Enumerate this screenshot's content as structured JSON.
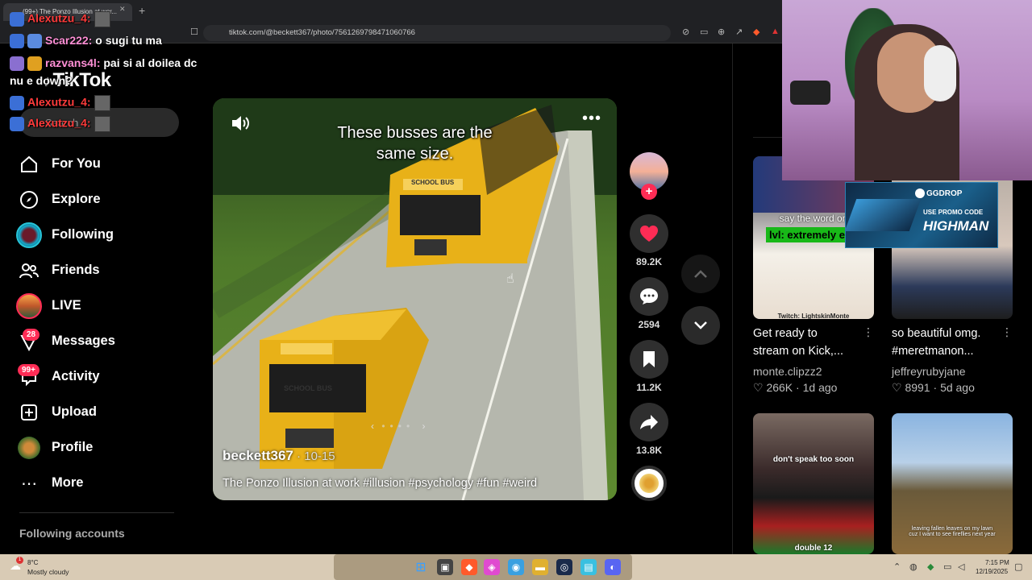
{
  "browser": {
    "tab_title": "(99+) The Ponzo Illusion at wor...",
    "url": "tiktok.com/@beckett367/photo/7561269798471060766"
  },
  "chat": [
    {
      "user": "Alexutzu_4:",
      "message": "",
      "color": "#ff3b3b"
    },
    {
      "user": "Scar222:",
      "message": "o sugi tu ma",
      "color": "#ff8fd6"
    },
    {
      "user": "razvans4l:",
      "message": "pai si al doilea dc",
      "color": "#ff8fd6"
    },
    {
      "user": "",
      "message": "nu e down?",
      "color": "#ffffff"
    },
    {
      "user": "Alexutzu_4:",
      "message": "",
      "color": "#ff3b3b"
    },
    {
      "user": "Alexutzu_4:",
      "message": "",
      "color": "#ff3b3b"
    }
  ],
  "app": {
    "logo": "TikTok",
    "search_placeholder": "Search"
  },
  "nav": [
    {
      "label": "For You",
      "icon": "home-icon"
    },
    {
      "label": "Explore",
      "icon": "compass-icon"
    },
    {
      "label": "Following",
      "icon": "following-avatar-icon"
    },
    {
      "label": "Friends",
      "icon": "friends-icon"
    },
    {
      "label": "LIVE",
      "icon": "live-avatar-icon"
    },
    {
      "label": "Messages",
      "icon": "messages-icon",
      "badge": "28"
    },
    {
      "label": "Activity",
      "icon": "activity-icon",
      "badge": "99+"
    },
    {
      "label": "Upload",
      "icon": "upload-icon"
    },
    {
      "label": "Profile",
      "icon": "profile-avatar-icon"
    },
    {
      "label": "More",
      "icon": "more-icon"
    }
  ],
  "sidebar": {
    "following_accounts": "Following accounts"
  },
  "video": {
    "caption": "These busses are the same size.",
    "author": "beckett367",
    "date": "10-15",
    "description": "The Ponzo Illusion at work #illusion #psychology #fun #weird",
    "bus_label": "SCHOOL BUS"
  },
  "actions": {
    "likes": "89.2K",
    "comments": "2594",
    "saves": "11.2K",
    "shares": "13.8K"
  },
  "recommendations": [
    {
      "title_line1": "Get ready to",
      "title_line2": "stream on Kick,...",
      "author": "monte.clipzz2",
      "likes": "266K",
      "age": "1d ago",
      "overlay_top": "say the word on",
      "overlay_bottom": "Twitch: LightskinMonte"
    },
    {
      "title_line1": "so beautiful omg.",
      "title_line2": "#meretmanon...",
      "author": "jeffreyrubyjane",
      "likes": "8991",
      "age": "5d ago"
    },
    {
      "overlay_top": "don't speak too soon",
      "overlay_bottom": "double 12"
    },
    {
      "overlay_top": "leaving fallen leaves on my lawn cuz I want to see fireflies next year"
    }
  ],
  "stream_overlay": {
    "chip": "lvl: extremely e",
    "promo_brand": "GGDROP",
    "promo_line1": "USE PROMO CODE",
    "promo_line2": "HIGHMAN"
  },
  "taskbar": {
    "temperature": "8°C",
    "weather": "Mostly cloudy",
    "time": "7:15 PM",
    "date": "12/19/2025"
  }
}
